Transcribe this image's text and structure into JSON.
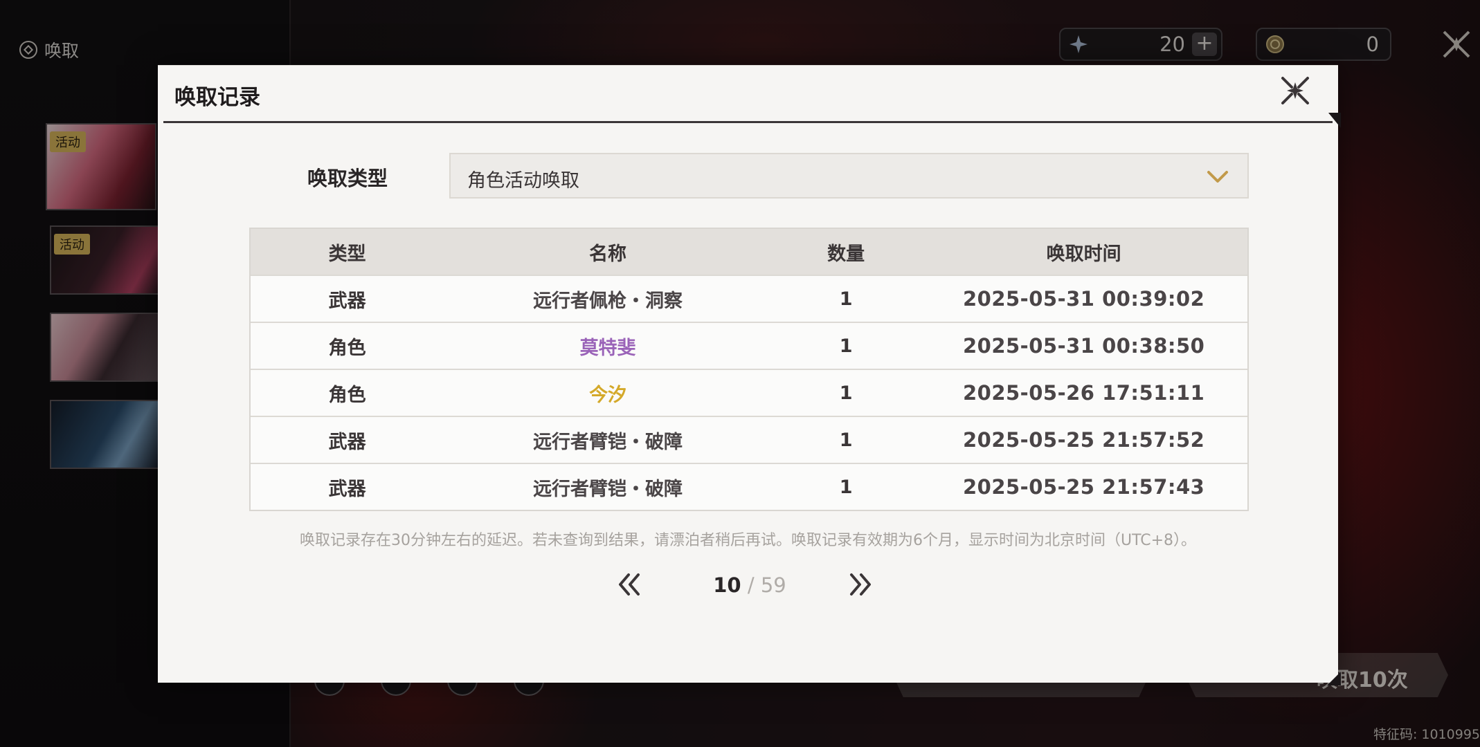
{
  "screen": {
    "title": "唤取",
    "currency": [
      {
        "icon": "astrite-star-icon",
        "amount": "20",
        "plus": "+"
      },
      {
        "icon": "lustrous-tide-coin-icon",
        "amount": "0"
      }
    ],
    "banner_tags": [
      "活动",
      "活动"
    ],
    "bottom_button_label": "唤取10次",
    "feature_code": "特征码: 1010995"
  },
  "modal": {
    "title": "唤取记录",
    "filter_label": "唤取类型",
    "filter_value": "角色活动唤取",
    "columns": [
      "类型",
      "名称",
      "数量",
      "唤取时间"
    ],
    "rows": [
      {
        "type": "武器",
        "name": "远行者佩枪・洞察",
        "qty": "1",
        "time": "2025-05-31 00:39:02",
        "name_color": "#4a4547"
      },
      {
        "type": "角色",
        "name": "莫特斐",
        "qty": "1",
        "time": "2025-05-31 00:38:50",
        "name_color": "#9a63b8"
      },
      {
        "type": "角色",
        "name": "今汐",
        "qty": "1",
        "time": "2025-05-26 17:51:11",
        "name_color": "#d4a92a"
      },
      {
        "type": "武器",
        "name": "远行者臂铠・破障",
        "qty": "1",
        "time": "2025-05-25 21:57:52",
        "name_color": "#4a4547"
      },
      {
        "type": "武器",
        "name": "远行者臂铠・破障",
        "qty": "1",
        "time": "2025-05-25 21:57:43",
        "name_color": "#4a4547"
      }
    ],
    "note": "唤取记录存在30分钟左右的延迟。若未查询到结果，请漂泊者稍后再试。唤取记录有效期为6个月，显示时间为北京时间（UTC+8）。",
    "pager": {
      "current": "10",
      "separator": "/",
      "total": "59"
    }
  }
}
